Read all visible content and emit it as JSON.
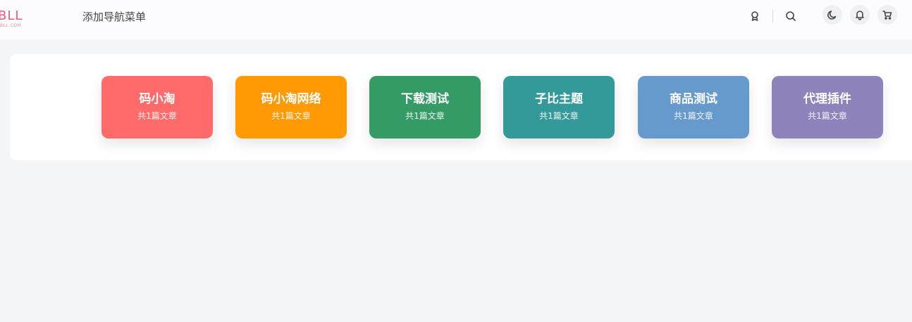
{
  "header": {
    "logo_text": "BLL",
    "logo_subtext": "BLL.COM",
    "nav_text": "添加导航菜单",
    "brand_color": "#f05a78",
    "icons": [
      "badge-icon",
      "search-icon",
      "moon-icon",
      "bell-icon",
      "cart-icon"
    ]
  },
  "categories": [
    {
      "title": "码小淘",
      "count": "共1篇文章",
      "color": "#ff6b6b"
    },
    {
      "title": "码小淘网络",
      "count": "共1篇文章",
      "color": "#ff9a05"
    },
    {
      "title": "下载测试",
      "count": "共1篇文章",
      "color": "#349a66"
    },
    {
      "title": "子比主题",
      "count": "共1篇文章",
      "color": "#349999"
    },
    {
      "title": "商品测试",
      "count": "共1篇文章",
      "color": "#6699cc"
    },
    {
      "title": "代理插件",
      "count": "共1篇文章",
      "color": "#8f83bc"
    }
  ]
}
